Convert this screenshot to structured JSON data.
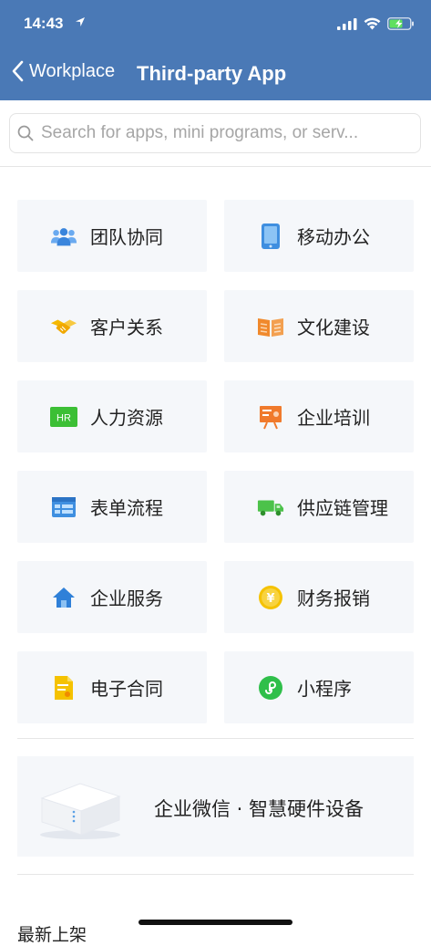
{
  "status_bar": {
    "time": "14:43"
  },
  "nav": {
    "back_label": "Workplace",
    "title": "Third-party App"
  },
  "search": {
    "placeholder": "Search for apps, mini programs, or serv..."
  },
  "categories": [
    {
      "label": "团队协同",
      "icon": "team-icon",
      "color": "#4a90e2"
    },
    {
      "label": "移动办公",
      "icon": "mobile-icon",
      "color": "#3f8fe0"
    },
    {
      "label": "客户关系",
      "icon": "handshake-icon",
      "color": "#f5b800"
    },
    {
      "label": "文化建设",
      "icon": "book-icon",
      "color": "#f08a2c"
    },
    {
      "label": "人力资源",
      "icon": "hr-icon",
      "color": "#3cbf35"
    },
    {
      "label": "企业培训",
      "icon": "presentation-icon",
      "color": "#f07a2c"
    },
    {
      "label": "表单流程",
      "icon": "form-icon",
      "color": "#3f8fe0"
    },
    {
      "label": "供应链管理",
      "icon": "truck-icon",
      "color": "#4cc24a"
    },
    {
      "label": "企业服务",
      "icon": "home-icon",
      "color": "#2f80d8"
    },
    {
      "label": "财务报销",
      "icon": "yuan-coin-icon",
      "color": "#f5c200"
    },
    {
      "label": "电子合同",
      "icon": "document-icon",
      "color": "#f5c200"
    },
    {
      "label": "小程序",
      "icon": "mini-program-icon",
      "color": "#2fbf4a"
    }
  ],
  "banner": {
    "label": "企业微信 · 智慧硬件设备"
  },
  "section": {
    "title": "最新上架"
  }
}
